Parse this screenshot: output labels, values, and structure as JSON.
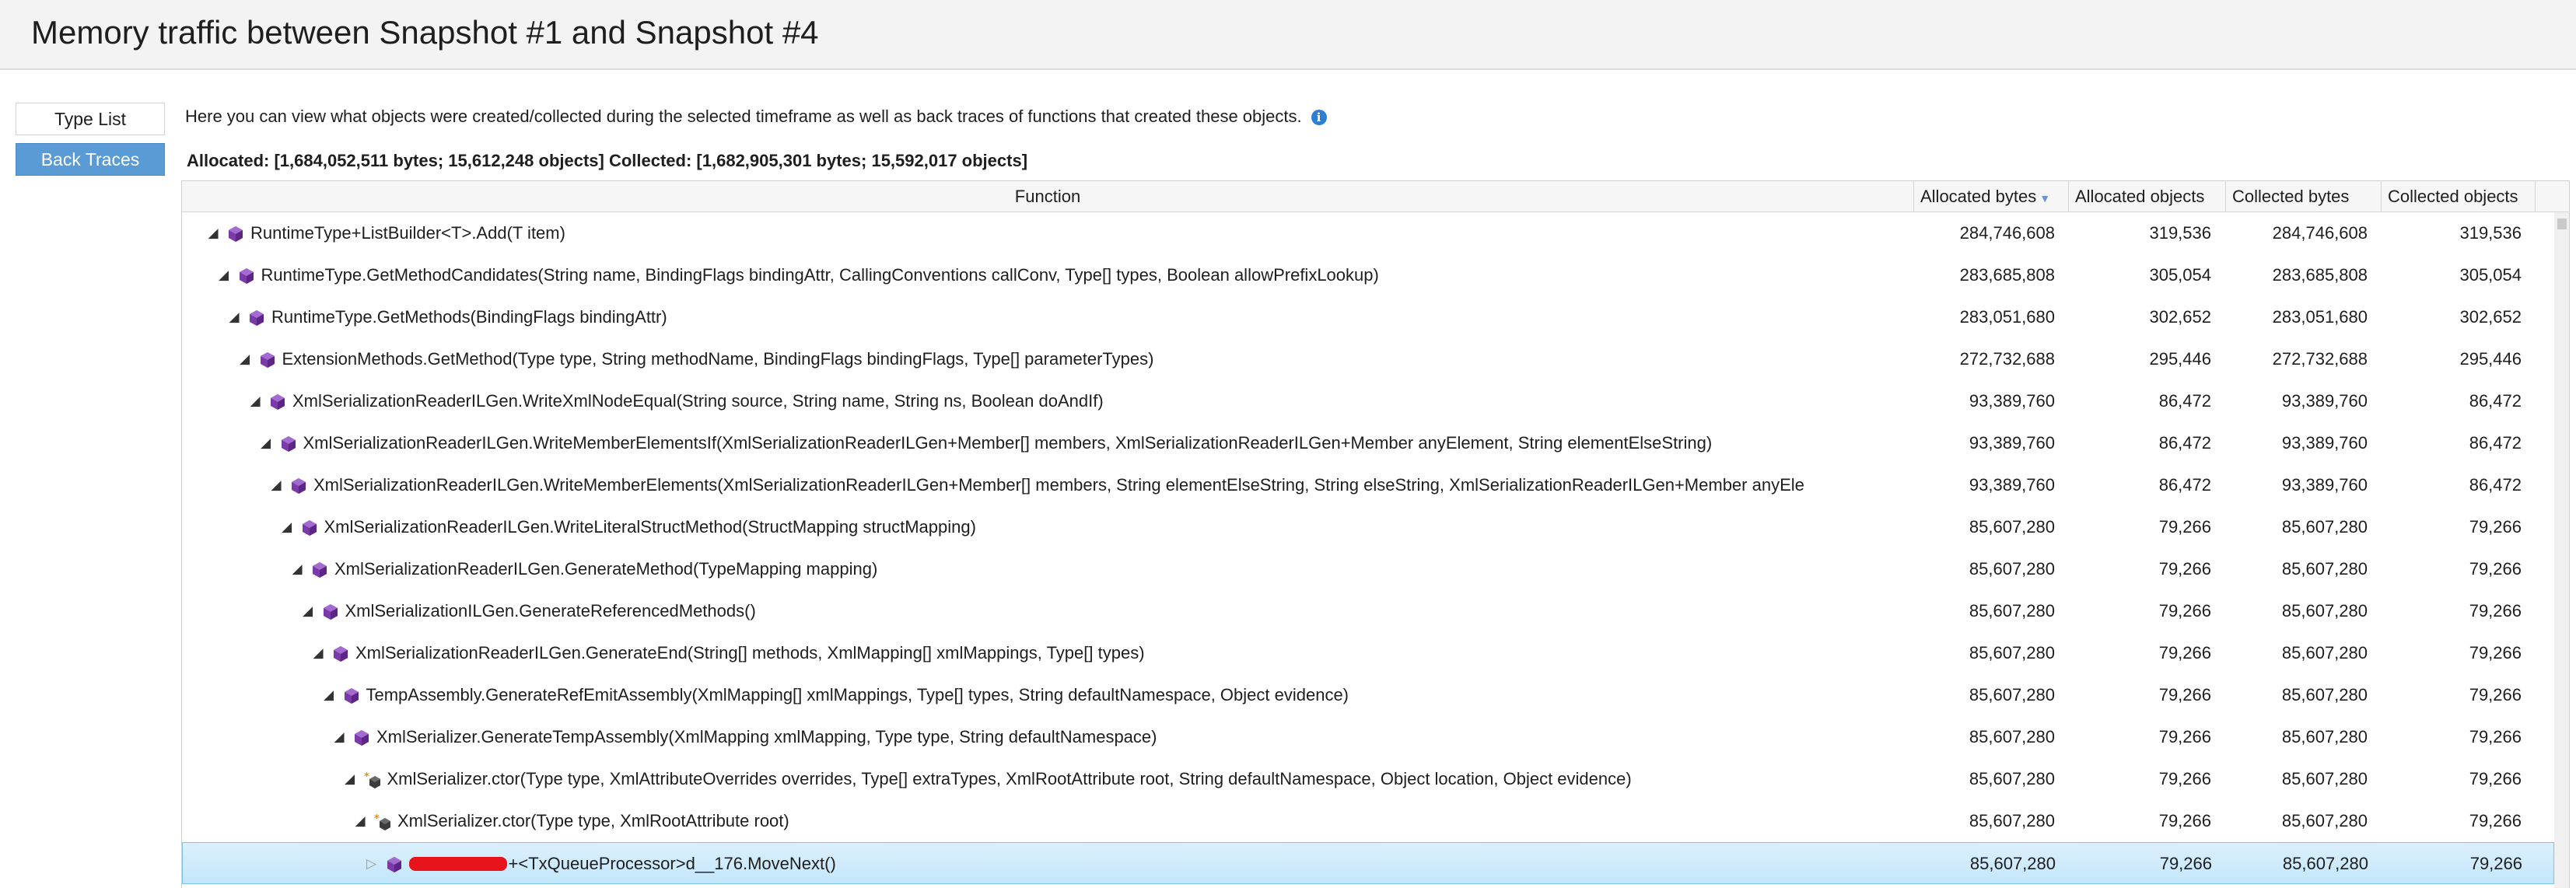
{
  "title": "Memory traffic between Snapshot #1 and Snapshot #4",
  "tabs": [
    "Type List",
    "Back Traces"
  ],
  "description": "Here you can view what objects were created/collected during the selected timeframe as well as back traces of functions that created these objects.",
  "summary": "Allocated: [1,684,052,511 bytes; 15,612,248 objects] Collected: [1,682,905,301 bytes; 15,592,017 objects]",
  "columns": {
    "function": "Function",
    "allocated_bytes": "Allocated bytes",
    "allocated_objects": "Allocated objects",
    "collected_bytes": "Collected bytes",
    "collected_objects": "Collected objects"
  },
  "sort": {
    "column": "Allocated bytes",
    "direction": "descending"
  },
  "colors": {
    "accent": "#5b9bd5",
    "method_icon": "#7a3aa8",
    "selected_row": "#cde8fb",
    "redaction": "#e8141c"
  },
  "rows": [
    {
      "depth": 0,
      "icon": "method-icon",
      "name": "RuntimeType+ListBuilder<T>.Add(T item)",
      "ab": "284,746,608",
      "ao": "319,536",
      "cb": "284,746,608",
      "co": "319,536"
    },
    {
      "depth": 1,
      "icon": "method-icon",
      "name": "RuntimeType.GetMethodCandidates(String name, BindingFlags bindingAttr, CallingConventions callConv, Type[] types, Boolean allowPrefixLookup)",
      "ab": "283,685,808",
      "ao": "305,054",
      "cb": "283,685,808",
      "co": "305,054"
    },
    {
      "depth": 2,
      "icon": "method-icon",
      "name": "RuntimeType.GetMethods(BindingFlags bindingAttr)",
      "ab": "283,051,680",
      "ao": "302,652",
      "cb": "283,051,680",
      "co": "302,652"
    },
    {
      "depth": 3,
      "icon": "method-icon",
      "name": "ExtensionMethods.GetMethod(Type type, String methodName, BindingFlags bindingFlags, Type[] parameterTypes)",
      "ab": "272,732,688",
      "ao": "295,446",
      "cb": "272,732,688",
      "co": "295,446"
    },
    {
      "depth": 4,
      "icon": "method-icon",
      "name": "XmlSerializationReaderILGen.WriteXmlNodeEqual(String source, String name, String ns, Boolean doAndIf)",
      "ab": "93,389,760",
      "ao": "86,472",
      "cb": "93,389,760",
      "co": "86,472"
    },
    {
      "depth": 5,
      "icon": "method-icon",
      "name": "XmlSerializationReaderILGen.WriteMemberElementsIf(XmlSerializationReaderILGen+Member[] members, XmlSerializationReaderILGen+Member anyElement, String elementElseString)",
      "ab": "93,389,760",
      "ao": "86,472",
      "cb": "93,389,760",
      "co": "86,472"
    },
    {
      "depth": 6,
      "icon": "method-icon",
      "name": "XmlSerializationReaderILGen.WriteMemberElements(XmlSerializationReaderILGen+Member[] members, String elementElseString, String elseString, XmlSerializationReaderILGen+Member anyEle",
      "ab": "93,389,760",
      "ao": "86,472",
      "cb": "93,389,760",
      "co": "86,472"
    },
    {
      "depth": 7,
      "icon": "method-icon",
      "name": "XmlSerializationReaderILGen.WriteLiteralStructMethod(StructMapping structMapping)",
      "ab": "85,607,280",
      "ao": "79,266",
      "cb": "85,607,280",
      "co": "79,266"
    },
    {
      "depth": 8,
      "icon": "method-icon",
      "name": "XmlSerializationReaderILGen.GenerateMethod(TypeMapping mapping)",
      "ab": "85,607,280",
      "ao": "79,266",
      "cb": "85,607,280",
      "co": "79,266"
    },
    {
      "depth": 9,
      "icon": "method-icon",
      "name": "XmlSerializationILGen.GenerateReferencedMethods()",
      "ab": "85,607,280",
      "ao": "79,266",
      "cb": "85,607,280",
      "co": "79,266"
    },
    {
      "depth": 10,
      "icon": "method-icon",
      "name": "XmlSerializationReaderILGen.GenerateEnd(String[] methods, XmlMapping[] xmlMappings, Type[] types)",
      "ab": "85,607,280",
      "ao": "79,266",
      "cb": "85,607,280",
      "co": "79,266"
    },
    {
      "depth": 11,
      "icon": "method-icon",
      "name": "TempAssembly.GenerateRefEmitAssembly(XmlMapping[] xmlMappings, Type[] types, String defaultNamespace, Object evidence)",
      "ab": "85,607,280",
      "ao": "79,266",
      "cb": "85,607,280",
      "co": "79,266"
    },
    {
      "depth": 12,
      "icon": "method-icon",
      "name": "XmlSerializer.GenerateTempAssembly(XmlMapping xmlMapping, Type type, String defaultNamespace)",
      "ab": "85,607,280",
      "ao": "79,266",
      "cb": "85,607,280",
      "co": "79,266"
    },
    {
      "depth": 13,
      "icon": "constructor-icon",
      "name": "XmlSerializer.ctor(Type type, XmlAttributeOverrides overrides, Type[] extraTypes, XmlRootAttribute root, String defaultNamespace, Object location, Object evidence)",
      "ab": "85,607,280",
      "ao": "79,266",
      "cb": "85,607,280",
      "co": "79,266"
    },
    {
      "depth": 14,
      "icon": "constructor-icon",
      "name": "XmlSerializer.ctor(Type type, XmlRootAttribute root)",
      "ab": "85,607,280",
      "ao": "79,266",
      "cb": "85,607,280",
      "co": "79,266"
    },
    {
      "depth": 15,
      "icon": "method-icon",
      "name": "+<TxQueueProcessor>d__176.MoveNext()",
      "ab": "85,607,280",
      "ao": "79,266",
      "cb": "85,607,280",
      "co": "79,266",
      "redacted": true,
      "collapsed": true,
      "selected": true
    }
  ]
}
